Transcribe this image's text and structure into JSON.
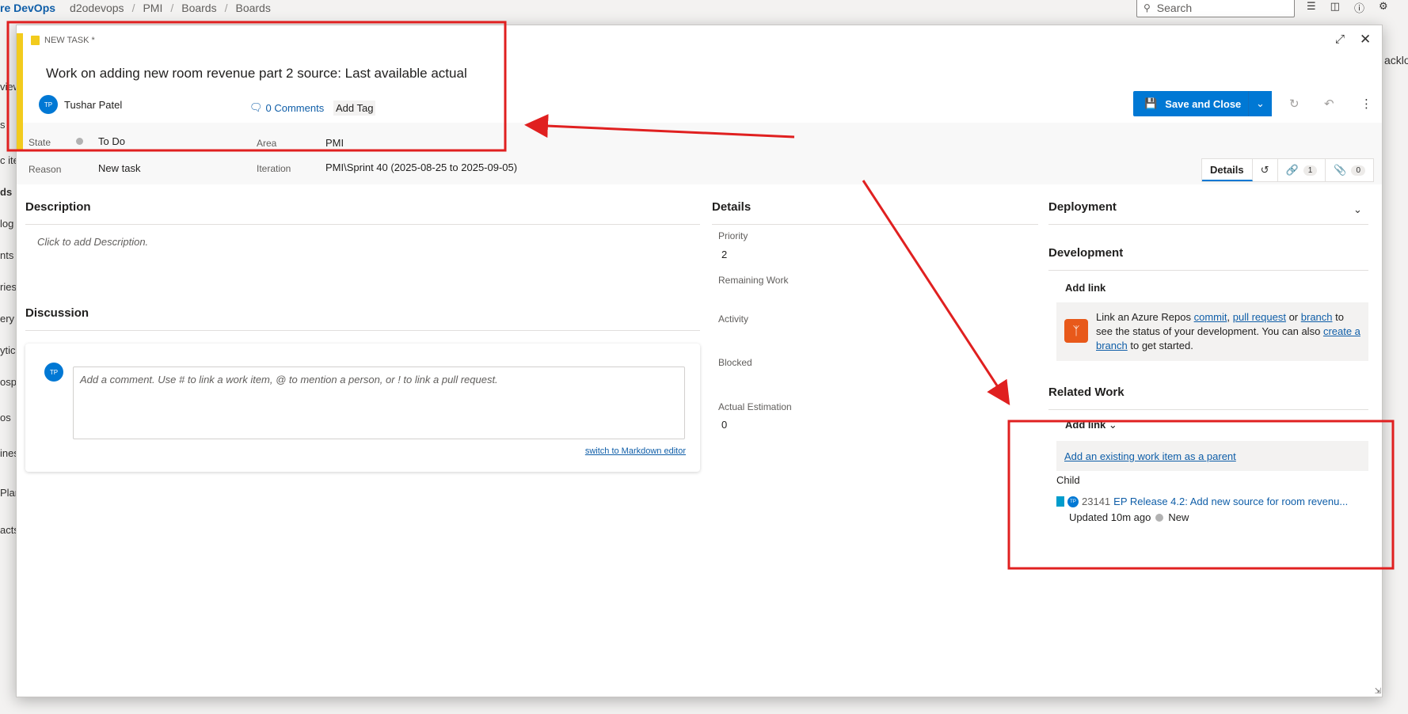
{
  "topbar": {
    "brand": "re DevOps",
    "crumbs": [
      "d2odevops",
      "PMI",
      "Boards",
      "Boards"
    ],
    "search_placeholder": "Search"
  },
  "sidebar_fragments": [
    "view",
    "s",
    "c ite",
    "ds",
    "log",
    "nts",
    "ries",
    "ery",
    "ytic",
    "ospe",
    "os",
    "ines",
    "Plan",
    "acts"
  ],
  "background_right": "acklo",
  "work_item": {
    "type_label": "NEW TASK *",
    "title": "Work on adding new room revenue part 2 source: Last available actual",
    "assignee": {
      "name": "Tushar Patel",
      "initials": "TP"
    },
    "comments_label": "0 Comments",
    "add_tag_label": "Add Tag",
    "save_label": "Save and Close",
    "fields": {
      "state_label": "State",
      "state_value": "To Do",
      "reason_label": "Reason",
      "reason_value": "New task",
      "area_label": "Area",
      "area_value": "PMI",
      "iteration_label": "Iteration",
      "iteration_value": "PMI\\Sprint 40 (2025-08-25 to 2025-09-05)"
    },
    "tabs": {
      "details_label": "Details",
      "links_count": "1",
      "attachments_count": "0"
    }
  },
  "description": {
    "title": "Description",
    "placeholder": "Click to add Description."
  },
  "discussion": {
    "title": "Discussion",
    "avatar_initials": "TP",
    "placeholder": "Add a comment. Use # to link a work item, @ to mention a person, or ! to link a pull request.",
    "markdown_link": "switch to Markdown editor"
  },
  "details": {
    "title": "Details",
    "priority_label": "Priority",
    "priority_value": "2",
    "remaining_label": "Remaining Work",
    "activity_label": "Activity",
    "blocked_label": "Blocked",
    "estimation_label": "Actual Estimation",
    "estimation_value": "0"
  },
  "deployment": {
    "title": "Deployment"
  },
  "development": {
    "title": "Development",
    "add_link": "Add link",
    "text_1": "Link an Azure Repos",
    "link_commit": "commit",
    "comma": ",",
    "link_pr": "pull request",
    "or": "or",
    "link_branch": "branch",
    "text_2": "to see the status of your development. You can also",
    "link_create_branch": "create a branch",
    "text_3": "to get started."
  },
  "related_work": {
    "title": "Related Work",
    "add_link": "Add link",
    "parent_link": "Add an existing work item as a parent",
    "child_label": "Child",
    "child": {
      "avatar_initials": "TP",
      "id": "23141",
      "title": "EP Release 4.2: Add new source for room revenu...",
      "updated": "Updated 10m ago",
      "status": "New"
    }
  },
  "colors": {
    "accent": "#0078d4",
    "annotation": "#e02020",
    "task_yellow": "#f2cb1d"
  }
}
